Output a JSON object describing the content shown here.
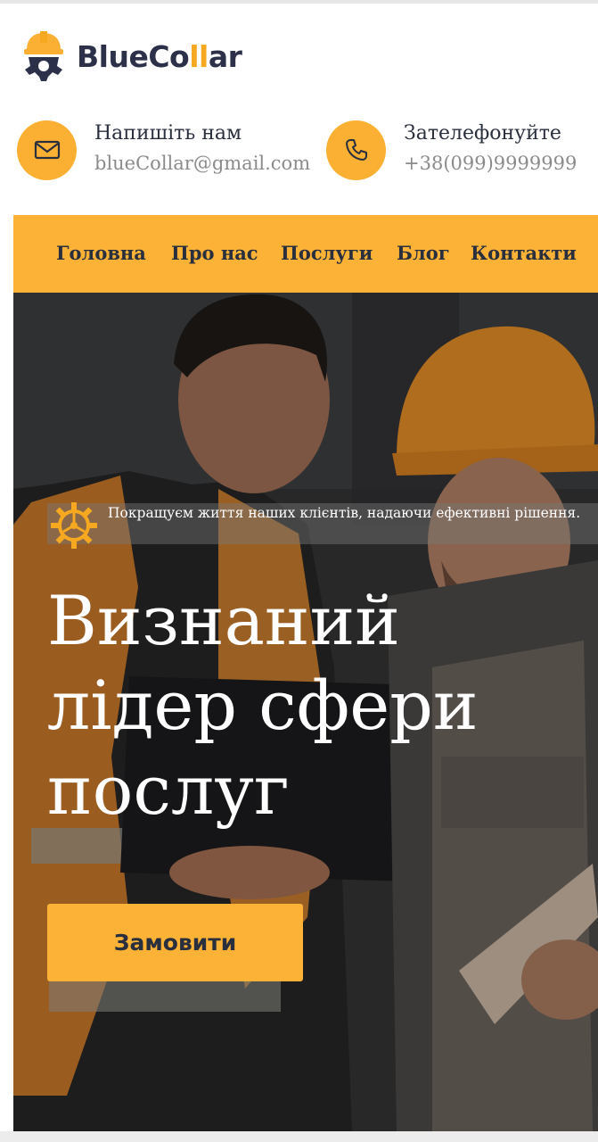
{
  "brand": {
    "name_part1": "BlueCo",
    "name_accent": "ll",
    "name_part2": "ar",
    "accent_color": "#f6a821",
    "dark_color": "#2c3149"
  },
  "contacts": {
    "email": {
      "icon": "envelope-icon",
      "title": "Напишіть нам",
      "value": "blueCollar@gmail.com"
    },
    "phone": {
      "icon": "phone-icon",
      "title": "Зателефонуйте",
      "value": "+38(099)9999999"
    }
  },
  "nav": {
    "items": [
      "Головна",
      "Про нас",
      "Послуги",
      "Блог",
      "Контакти"
    ],
    "background": "#fbb237"
  },
  "hero": {
    "tagline": "Покращуєм життя наших клієнтів, надаючи ефективні рішення.",
    "title_lines": [
      "Визнаний",
      "лідер сфери",
      "послуг"
    ],
    "cta_label": "Замовити"
  }
}
